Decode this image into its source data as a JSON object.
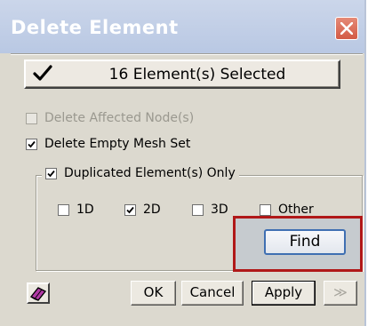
{
  "window": {
    "title": "Delete Element",
    "close_icon": "close-icon"
  },
  "selection": {
    "label": "16 Element(s) Selected",
    "checked": true
  },
  "options": {
    "delete_affected_nodes": {
      "label": "Delete Affected Node(s)",
      "checked": false,
      "enabled": false
    },
    "delete_empty_mesh_set": {
      "label": "Delete Empty Mesh Set",
      "checked": true,
      "enabled": true
    },
    "duplicated_only": {
      "label": "Duplicated Element(s) Only",
      "checked": true,
      "enabled": true
    }
  },
  "element_types": [
    {
      "label": "1D",
      "checked": false
    },
    {
      "label": "2D",
      "checked": true
    },
    {
      "label": "3D",
      "checked": false
    },
    {
      "label": "Other",
      "checked": false
    }
  ],
  "find_button": {
    "label": "Find"
  },
  "footer": {
    "eraser_icon": "eraser-icon",
    "ok_label": "OK",
    "cancel_label": "Cancel",
    "apply_label": "Apply",
    "more_label": "≫"
  },
  "colors": {
    "title_bar": "#bac8e3",
    "dialog_bg": "#dcd9cf",
    "highlight_border": "#b01818",
    "find_border": "#3f6fb2"
  }
}
